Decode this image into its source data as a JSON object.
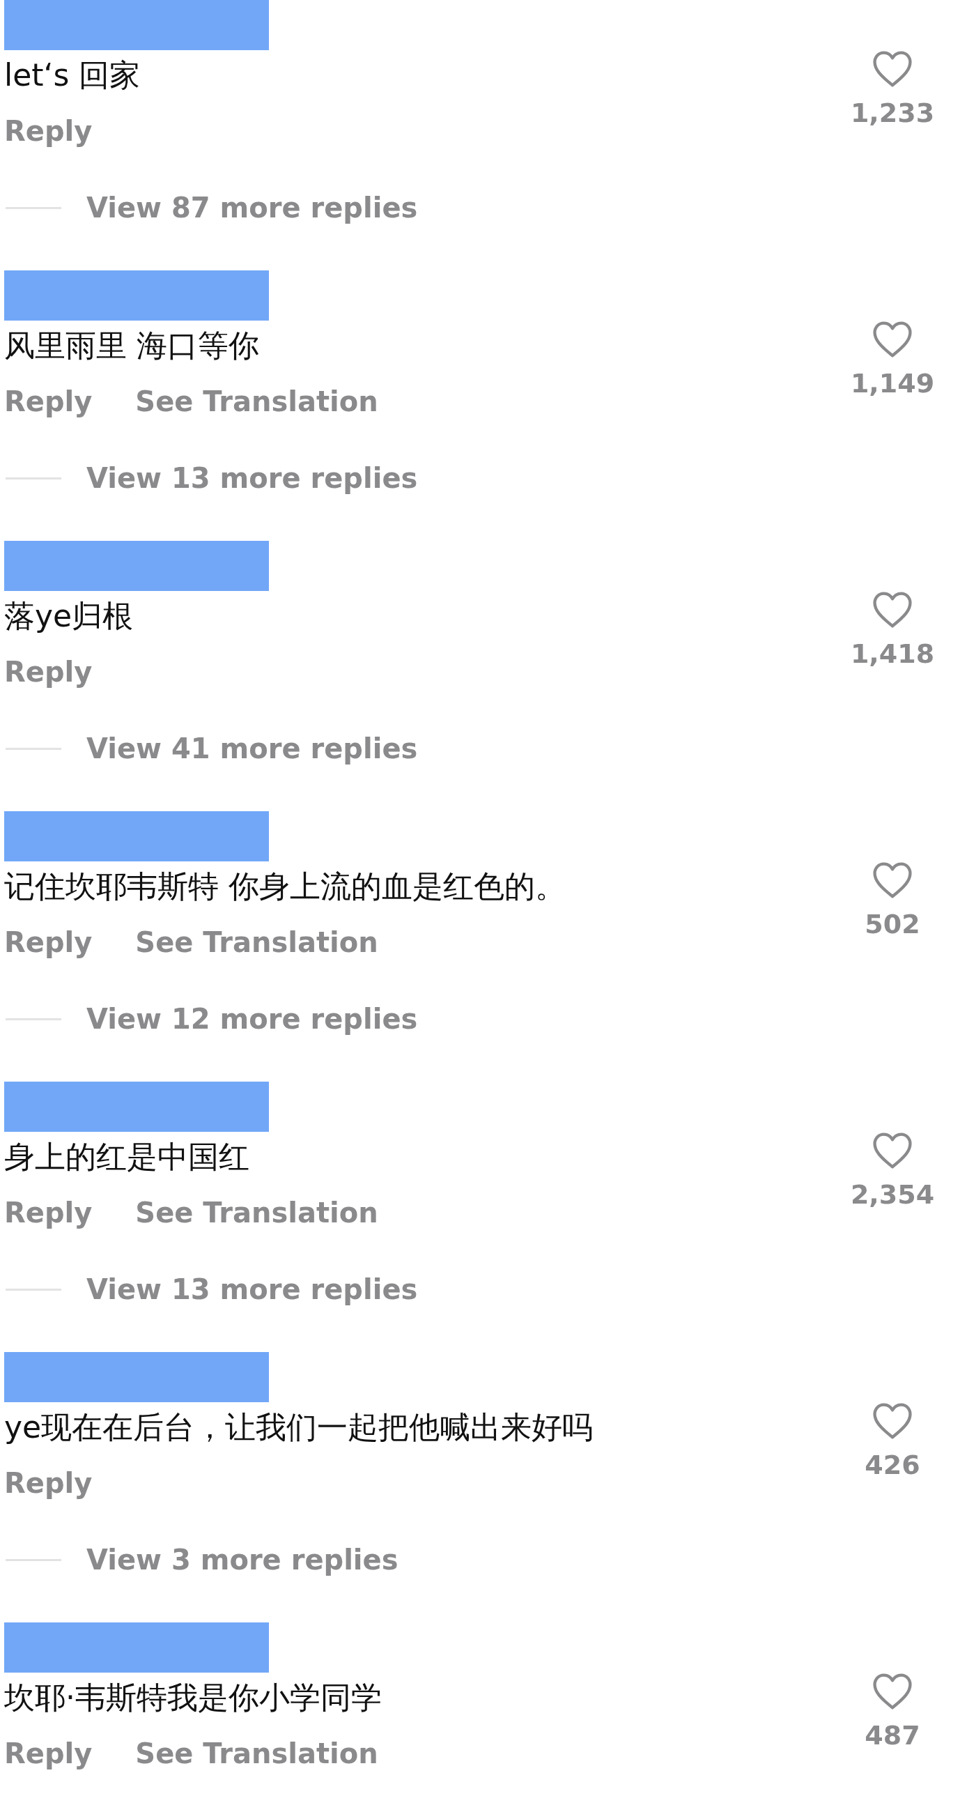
{
  "comments": [
    {
      "text": "let‘s 回家",
      "actions": [
        "Reply"
      ],
      "likes": "1,233",
      "view_replies": "View 87 more replies"
    },
    {
      "text": "风里雨里 海口等你",
      "actions": [
        "Reply",
        "See Translation"
      ],
      "likes": "1,149",
      "view_replies": "View 13 more replies"
    },
    {
      "text": "落ye归根",
      "actions": [
        "Reply"
      ],
      "likes": "1,418",
      "view_replies": "View 41 more replies"
    },
    {
      "text": "记住坎耶韦斯特 你身上流的血是红色的。",
      "actions": [
        "Reply",
        "See Translation"
      ],
      "likes": "502",
      "view_replies": "View 12 more replies"
    },
    {
      "text": "身上的红是中国红",
      "actions": [
        "Reply",
        "See Translation"
      ],
      "likes": "2,354",
      "view_replies": "View 13 more replies"
    },
    {
      "text": "ye现在在后台，让我们一起把他喊出来好吗",
      "actions": [
        "Reply"
      ],
      "likes": "426",
      "view_replies": "View 3 more replies"
    },
    {
      "text": "坎耶·韦斯特我是你小学同学",
      "actions": [
        "Reply",
        "See Translation"
      ],
      "likes": "487"
    }
  ]
}
